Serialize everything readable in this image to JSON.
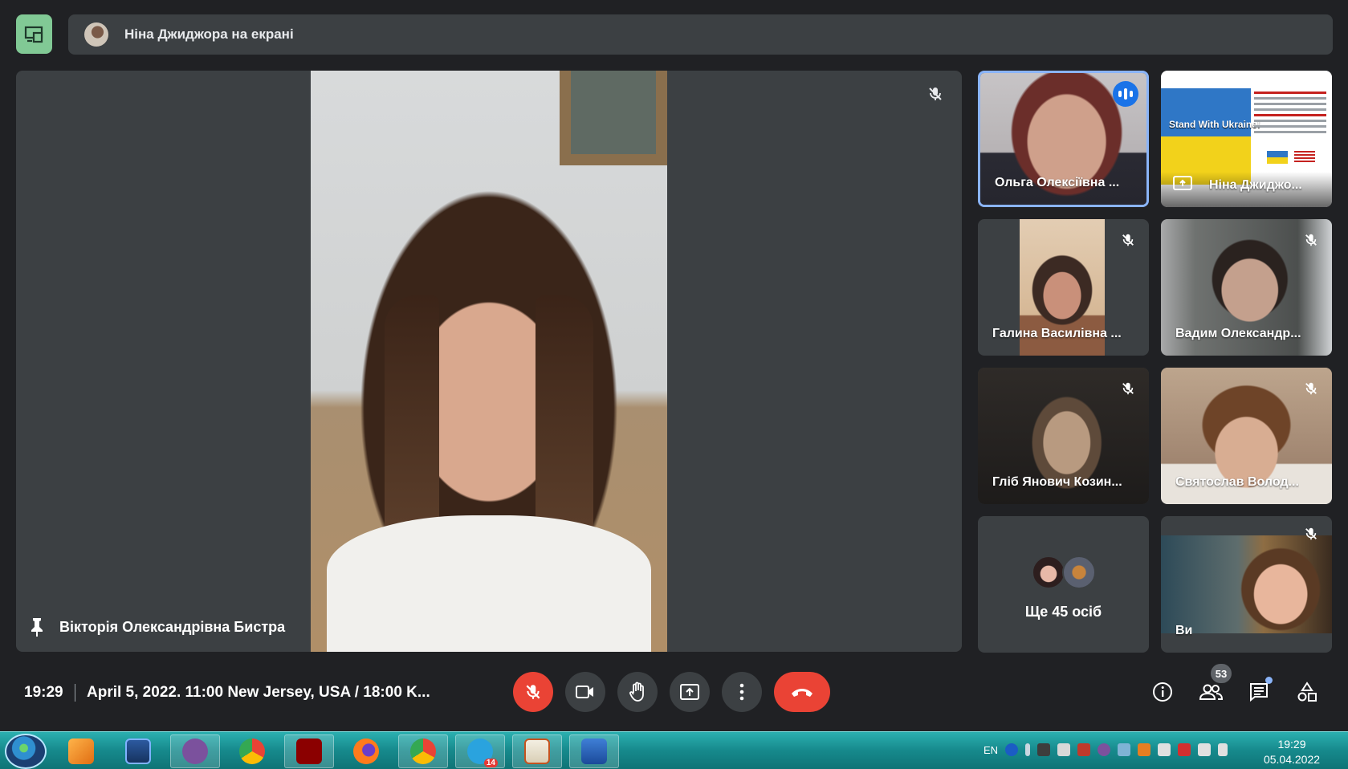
{
  "banner": {
    "text": "Ніна Джиджора на екрані"
  },
  "stage": {
    "name": "Вікторія Олександрівна Бистра"
  },
  "tiles": [
    {
      "name": "Ольга Олексіївна ..."
    },
    {
      "name": "Ніна Джиджо..."
    },
    {
      "name": "Галина Василівна ..."
    },
    {
      "name": "Вадим Олександр..."
    },
    {
      "name": "Гліб Янович Козин..."
    },
    {
      "name": "Святослав Волод..."
    },
    {
      "more": "Ще 45 осіб"
    },
    {
      "name": "Ви"
    }
  ],
  "slide": {
    "title": "Stand With Ukraine!"
  },
  "bottom": {
    "time": "19:29",
    "meeting": "April 5, 2022. 11:00 New Jersey, USA / 18:00 K...",
    "people_count": "53"
  },
  "taskbar": {
    "lang": "EN",
    "clock_time": "19:29",
    "clock_date": "05.04.2022",
    "telegram_badge": "14"
  },
  "colors": {
    "accent": "#8ab4f8",
    "end_call": "#ea4335",
    "present": "#81c995",
    "panel": "#3c4043",
    "bg": "#202124"
  },
  "icons": [
    "present-screen-icon",
    "mic-off-icon",
    "pin-icon",
    "audio-active-icon",
    "camera-icon",
    "raise-hand-icon",
    "present-now-icon",
    "more-options-icon",
    "end-call-icon",
    "info-icon",
    "people-icon",
    "chat-icon",
    "activities-icon"
  ]
}
